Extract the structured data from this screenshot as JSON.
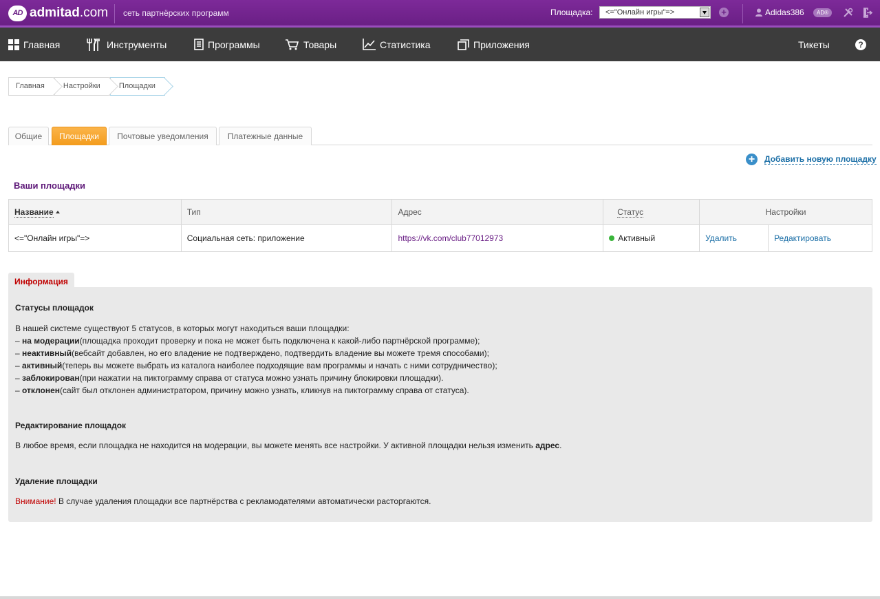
{
  "header": {
    "logo_mark": "AD",
    "logo_bold": "admitad",
    "logo_rest": ".com",
    "subtitle": "сеть партнёрских программ",
    "site_label": "Площадка:",
    "site_select_value": "<=\"Онлайн игры\"=>",
    "username": "Adidas386",
    "badge": "AD®"
  },
  "nav": {
    "items": [
      "Главная",
      "Инструменты",
      "Программы",
      "Товары",
      "Статистика",
      "Приложения"
    ],
    "tickets": "Тикеты"
  },
  "breadcrumb": [
    "Главная",
    "Настройки",
    "Площадки"
  ],
  "tabs": [
    "Общие",
    "Площадки",
    "Почтовые уведомления",
    "Платежные данные"
  ],
  "add_site": "Добавить новую площадку",
  "sites_title": "Ваши площадки",
  "table": {
    "headers": [
      "Название",
      "Тип",
      "Адрес",
      "Статус",
      "Настройки"
    ],
    "rows": [
      {
        "name": "<=\"Онлайн игры\"=>",
        "type": "Социальная сеть: приложение",
        "address": "https://vk.com/club77012973",
        "status": "Активный",
        "delete": "Удалить",
        "edit": "Редактировать"
      }
    ]
  },
  "info": {
    "tab": "Информация",
    "statuses_title": "Статусы площадок",
    "statuses_intro": "В нашей системе существуют 5 статусов, в которых могут находиться ваши площадки:",
    "statuses": [
      {
        "dash": "– ",
        "name": "на модерации",
        "desc": "(площадка проходит проверку и пока не может быть подключена к какой-либо партнёрской программе);"
      },
      {
        "dash": "– ",
        "name": "неактивный",
        "desc": "(вебсайт добавлен, но его владение не подтверждено, подтвердить владение вы можете тремя способами);"
      },
      {
        "dash": "– ",
        "name": "активный",
        "desc": "(теперь вы можете выбрать из каталога наиболее подходящие вам программы и начать с ними сотрудничество);"
      },
      {
        "dash": "– ",
        "name": "заблокирован",
        "desc": "(при нажатии на пиктограмму справа от статуса можно узнать причину блокировки площадки)."
      },
      {
        "dash": "– ",
        "name": "отклонен",
        "desc": "(сайт был отклонен администратором, причину можно узнать, кликнув на пиктограмму справа от статуса)."
      }
    ],
    "edit_title": "Редактирование площадок",
    "edit_text": "В любое время, если площадка не находится на модерации, вы можете менять все настройки. У активной площадки нельзя изменить ",
    "edit_bold": "адрес",
    "edit_end": ".",
    "delete_title": "Удаление площадки",
    "delete_warn": "Внимание!",
    "delete_text": " В случае удаления площадки все партнёрства с рекламодателями автоматически расторгаются."
  },
  "colors": {
    "brand_purple": "#6a1f85",
    "nav_dark": "#3c3c3c",
    "active_tab_orange": "#f39c1d",
    "link_blue": "#1a6ea6",
    "status_green": "#39b53a",
    "warning_red": "#c00000"
  }
}
